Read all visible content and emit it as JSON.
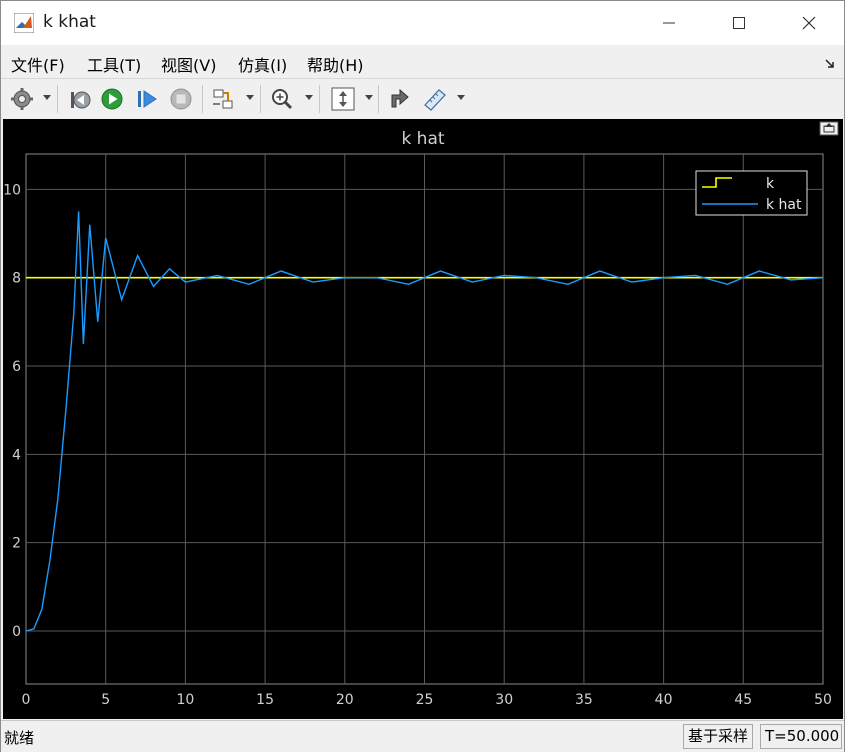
{
  "window": {
    "title": "k khat"
  },
  "menu": [
    "文件(F)",
    "工具(T)",
    "视图(V)",
    "仿真(I)",
    "帮助(H)"
  ],
  "toolbar": {
    "icons": [
      "gear-icon",
      "step-back-icon",
      "run-icon",
      "step-forward-icon",
      "stop-icon",
      "highlight-block-icon",
      "zoom-icon",
      "autoscale-icon",
      "style-icon",
      "measure-icon"
    ]
  },
  "status": {
    "state": "就绪",
    "sample_mode": "基于采样",
    "time": "T=50.000"
  },
  "colors": {
    "k": "#ffff00",
    "khat": "#1a9bff",
    "background": "#000000",
    "grid": "#5a5a5a",
    "axis_text": "#d0d0d0"
  },
  "chart_data": {
    "type": "line",
    "title": "k hat",
    "xlim": [
      0,
      50
    ],
    "ylim": [
      -1.2,
      10.8
    ],
    "xticks": [
      "0",
      "5",
      "10",
      "15",
      "20",
      "25",
      "30",
      "35",
      "40",
      "45",
      "50"
    ],
    "yticks": [
      "0",
      "2",
      "4",
      "6",
      "8",
      "10"
    ],
    "grid": true,
    "legend_position": "top-right",
    "series": [
      {
        "name": "k",
        "x": [
          0,
          50
        ],
        "y": [
          8,
          8
        ]
      },
      {
        "name": "k hat",
        "x": [
          0,
          0.5,
          1,
          1.5,
          2,
          2.5,
          3,
          3.3,
          3.6,
          4,
          4.5,
          5,
          6,
          7,
          8,
          9,
          10,
          12,
          14,
          16,
          18,
          20,
          22,
          24,
          26,
          28,
          30,
          32,
          34,
          36,
          38,
          40,
          42,
          44,
          46,
          48,
          50
        ],
        "y": [
          0,
          0.05,
          0.5,
          1.6,
          3.0,
          5.0,
          7.2,
          9.5,
          6.5,
          9.2,
          7.0,
          8.9,
          7.5,
          8.5,
          7.8,
          8.2,
          7.9,
          8.05,
          7.85,
          8.15,
          7.9,
          8.0,
          8.0,
          7.85,
          8.15,
          7.9,
          8.05,
          8.0,
          7.85,
          8.15,
          7.9,
          8.0,
          8.05,
          7.85,
          8.15,
          7.95,
          8.0
        ]
      }
    ]
  }
}
